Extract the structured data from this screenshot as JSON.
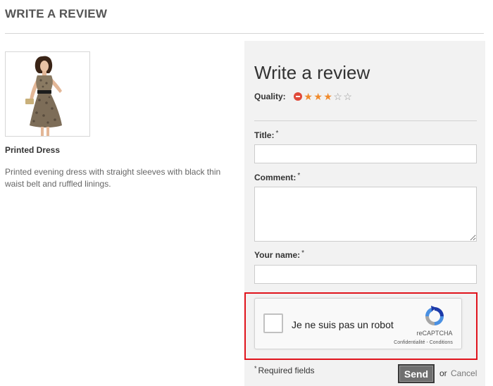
{
  "page": {
    "heading": "WRITE A REVIEW"
  },
  "product": {
    "name": "Printed Dress",
    "description": "Printed evening dress with straight sleeves with black thin waist belt and ruffled linings.",
    "image_icon": "dress-photo"
  },
  "review_form": {
    "title": "Write a review",
    "quality_label": "Quality:",
    "quality_rating": 3,
    "quality_max": 5,
    "fields": {
      "title_label": "Title:",
      "comment_label": "Comment:",
      "name_label": "Your name:",
      "required_mark": "*",
      "title_value": "",
      "comment_value": "",
      "name_value": ""
    },
    "captcha": {
      "label": "Je ne suis pas un robot",
      "brand": "reCAPTCHA",
      "links": "Confidentialité - Conditions"
    },
    "required_note_mark": "*",
    "required_note": "Required fields",
    "send_label": "Send",
    "or_text": "or",
    "cancel_label": "Cancel"
  },
  "colors": {
    "star_active": "#f08a2c",
    "star_inactive": "#999999",
    "cancel_rating": "#e04a3a",
    "captcha_highlight": "#e0131c",
    "send_button": "#6f6f6f",
    "panel_background": "#f2f2f2"
  }
}
